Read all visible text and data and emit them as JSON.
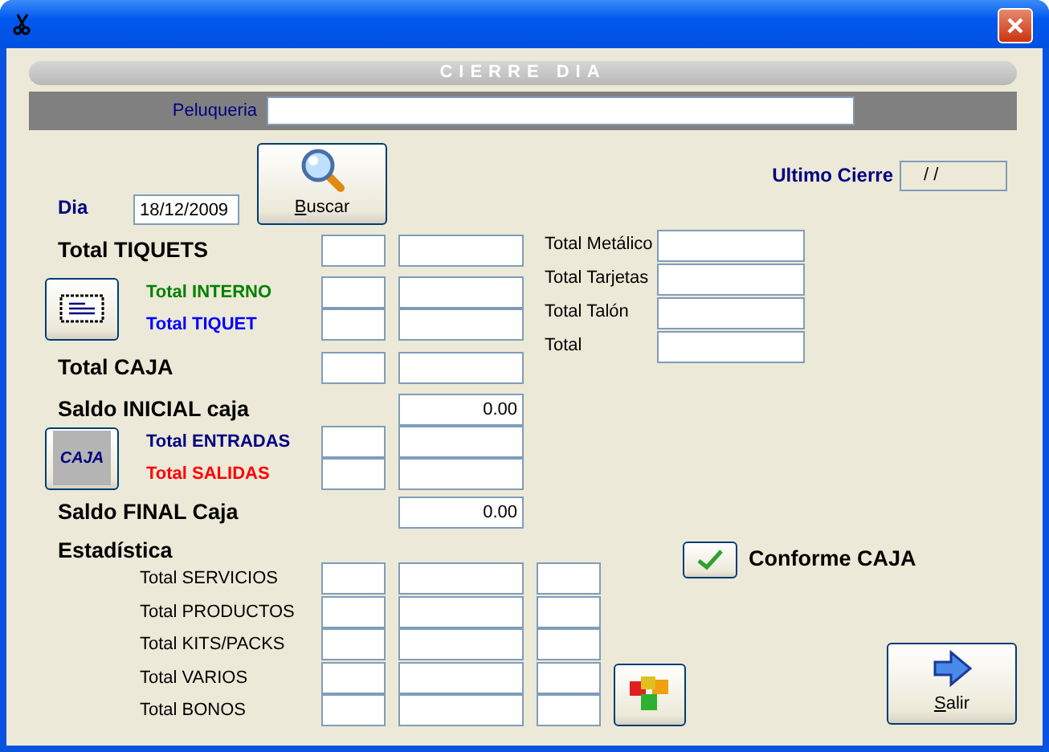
{
  "header": "CIERRE DIA",
  "salon": {
    "label": "Peluqueria"
  },
  "day": {
    "label": "Dia",
    "value": "18/12/2009"
  },
  "search_button": {
    "label": "Buscar",
    "mnemonic": true
  },
  "last_close": {
    "label": "Ultimo Cierre",
    "value": "/ /"
  },
  "left_rows": [
    {
      "kind": "heading",
      "label": "Total TIQUETS",
      "fields": [
        {
          "kind": "small"
        },
        {
          "kind": "wide"
        }
      ]
    },
    {
      "kind": "group",
      "button": {
        "kind": "ticket"
      },
      "rows": [
        {
          "label": "Total INTERNO",
          "color": "#008000",
          "fields": [
            {
              "kind": "small"
            },
            {
              "kind": "wide"
            }
          ]
        },
        {
          "label": "Total TIQUET",
          "color": "#0000ff",
          "fields": [
            {
              "kind": "small"
            },
            {
              "kind": "wide"
            }
          ]
        }
      ]
    },
    {
      "kind": "heading",
      "label": "Total CAJA",
      "fields": [
        {
          "kind": "small"
        },
        {
          "kind": "wide"
        }
      ]
    },
    {
      "kind": "heading",
      "label": "Saldo INICIAL caja",
      "fields": [
        {
          "kind": "wide",
          "value": "0.00"
        }
      ]
    },
    {
      "kind": "group",
      "button": {
        "kind": "cash",
        "text": "CAJA"
      },
      "rows": [
        {
          "label": "Total ENTRADAS",
          "color": "#000080",
          "fields": [
            {
              "kind": "small"
            },
            {
              "kind": "wide"
            }
          ]
        },
        {
          "label": "Total SALIDAS",
          "color": "#ff0000",
          "fields": [
            {
              "kind": "small"
            },
            {
              "kind": "wide"
            }
          ]
        }
      ]
    },
    {
      "kind": "heading",
      "label": "Saldo FINAL Caja",
      "fields": [
        {
          "kind": "wide",
          "value": "0.00"
        }
      ]
    }
  ],
  "payments": [
    {
      "label": "Total Metálico"
    },
    {
      "label": "Total Tarjetas"
    },
    {
      "label": "Total Talón"
    },
    {
      "label": "Total"
    }
  ],
  "statistics": {
    "title": "Estadística",
    "rows": [
      {
        "label": "Total SERVICIOS",
        "fields": [
          {
            "kind": "small"
          },
          {
            "kind": "wide"
          },
          {
            "kind": "small"
          }
        ]
      },
      {
        "label": "Total PRODUCTOS",
        "fields": [
          {
            "kind": "small"
          },
          {
            "kind": "wide"
          },
          {
            "kind": "small"
          }
        ]
      },
      {
        "label": "Total KITS/PACKS",
        "fields": [
          {
            "kind": "small"
          },
          {
            "kind": "wide"
          },
          {
            "kind": "small"
          }
        ]
      },
      {
        "label": "Total VARIOS",
        "fields": [
          {
            "kind": "small"
          },
          {
            "kind": "wide"
          },
          {
            "kind": "small"
          }
        ]
      },
      {
        "label": "Total BONOS",
        "fields": [
          {
            "kind": "small"
          },
          {
            "kind": "wide"
          },
          {
            "kind": "small"
          }
        ]
      }
    ]
  },
  "confirm": {
    "label": "Conforme CAJA"
  },
  "exit_button": {
    "label": "Salir",
    "mnemonic": true
  }
}
